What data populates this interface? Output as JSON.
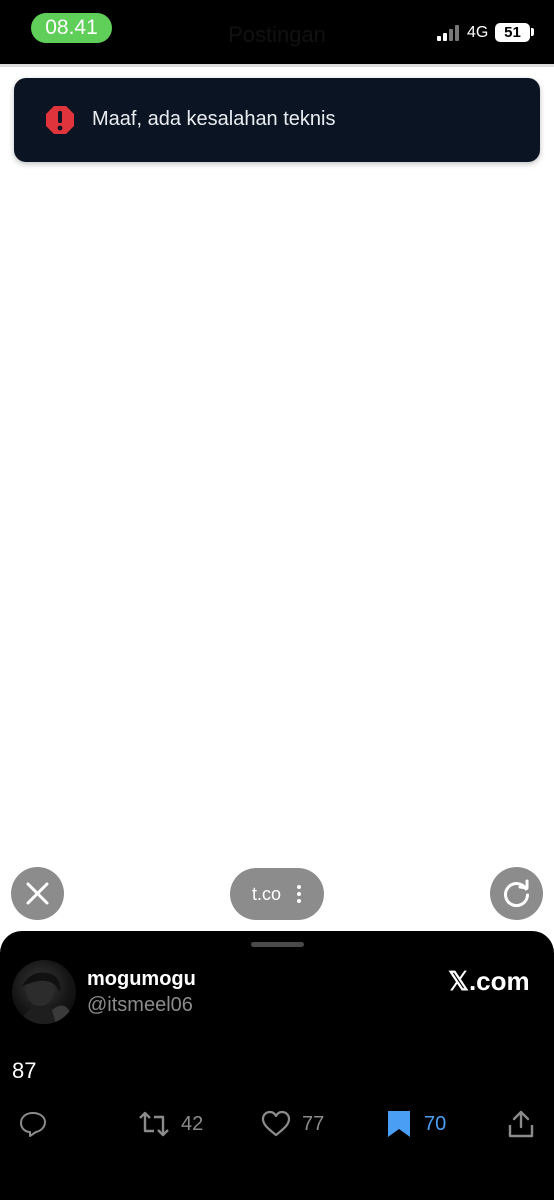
{
  "status_bar": {
    "time": "08.41",
    "network": "4G",
    "battery": "51",
    "ghost_title": "Postingan"
  },
  "toast": {
    "icon": "alert-octagon-icon",
    "message": "Maaf, ada kesalahan teknis",
    "background": "#0b1422",
    "icon_color": "#e0343c"
  },
  "floating_controls": {
    "close_icon": "close-icon",
    "url": "t.co",
    "reload_icon": "reload-icon"
  },
  "tweet_card": {
    "name": "mogumogu",
    "handle": "@itsmeel06",
    "brand": "𝕏.com",
    "text": "87",
    "actions": {
      "reply_icon": "reply-icon",
      "retweet_count": "42",
      "like_count": "77",
      "bookmark_count": "70",
      "share_icon": "share-icon"
    },
    "accent": "#4a9ff5"
  }
}
